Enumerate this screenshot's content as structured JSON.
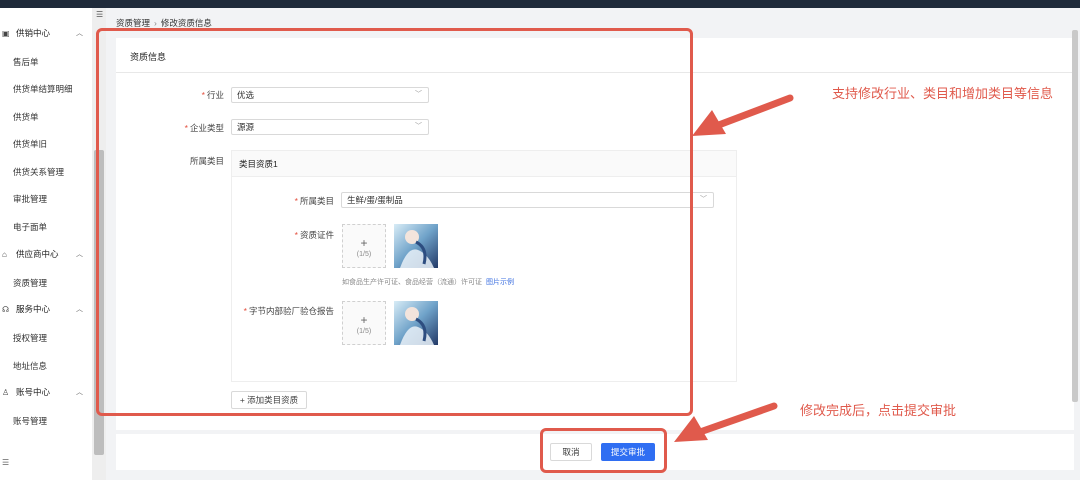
{
  "sidebar": {
    "top_partial": "",
    "groups": [
      {
        "label": "供销中心",
        "icon": "box-icon",
        "items": [
          "售后单",
          "供货单结算明细",
          "供货单",
          "供货单旧",
          "供货关系管理",
          "审批管理",
          "电子面单"
        ]
      },
      {
        "label": "供应商中心",
        "icon": "store-icon",
        "items": [
          "资质管理"
        ]
      },
      {
        "label": "服务中心",
        "icon": "headset-icon",
        "items": [
          "授权管理",
          "地址信息"
        ]
      },
      {
        "label": "账号中心",
        "icon": "user-icon",
        "items": [
          "账号管理"
        ]
      }
    ],
    "bottom_icon": "menu-icon"
  },
  "breadcrumb": [
    "资质管理",
    "修改资质信息"
  ],
  "card": {
    "title": "资质信息",
    "industry": {
      "label": "行业",
      "value": "优选"
    },
    "company_type": {
      "label": "企业类型",
      "value": "源源"
    },
    "category_section_label": "所属类目",
    "category_block": {
      "title": "类目资质1",
      "category": {
        "label": "所属类目",
        "value": "生鲜/蛋/蛋制品"
      },
      "cert": {
        "label": "资质证件",
        "upload_count": "(1/5)"
      },
      "hint": "如食品生产许可证、食品经营（流通）许可证",
      "hint_link": "图片示例",
      "report": {
        "label": "字节内部验厂验仓报告",
        "upload_count": "(1/5)"
      }
    },
    "add_button": "+ 添加类目资质"
  },
  "footer": {
    "cancel": "取消",
    "submit": "提交审批"
  },
  "annotations": {
    "top": "支持修改行业、类目和增加类目等信息",
    "bottom": "修改完成后，点击提交审批"
  },
  "colors": {
    "accent": "#2f6ef2",
    "annotation": "#e05a4c",
    "required": "#e34d3c"
  }
}
